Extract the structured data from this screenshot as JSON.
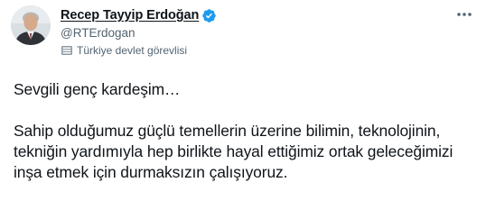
{
  "author": {
    "display_name": "Recep Tayyip Erdoğan",
    "handle": "@RTErdogan",
    "account_label": "Türkiye devlet görevlisi",
    "verified": true
  },
  "icons": {
    "avatar": "profile-photo",
    "verified": "verified-badge-icon",
    "label": "government-flag-icon",
    "more": "more-options-icon"
  },
  "colors": {
    "verified": "#1d9bf0",
    "secondary_text": "#536471",
    "primary_text": "#0f1419"
  },
  "tweet": {
    "text": "Sevgili genç kardeşim…\n\nSahip olduğumuz güçlü temellerin üzerine bilimin, teknolojinin, tekniğin yardımıyla hep birlikte hayal ettiğimiz ortak geleceğimizi inşa etmek için durmaksızın çalışıyoruz."
  }
}
